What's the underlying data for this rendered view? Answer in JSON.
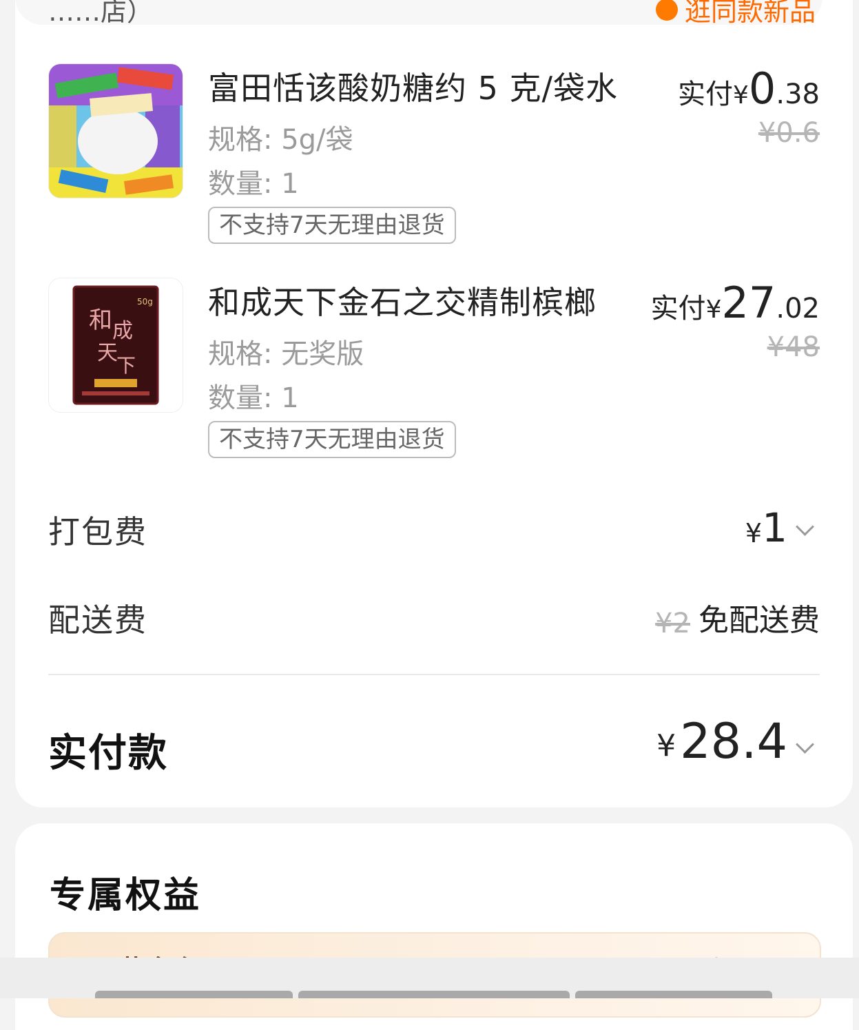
{
  "store": {
    "address_partial": "……店）",
    "right_partial": "逛同款新品"
  },
  "items": [
    {
      "name": "富田恬该酸奶糖约 5 克/袋水",
      "spec": "规格: 5g/袋",
      "qty": "数量: 1",
      "tag": "不支持7天无理由退货",
      "paid_label": "实付",
      "currency": "¥",
      "paid_int": "0",
      "paid_dec": ".38",
      "original": "¥0.6"
    },
    {
      "name": "和成天下金石之交精制槟榔",
      "spec": "规格: 无奖版",
      "qty": "数量: 1",
      "tag": "不支持7天无理由退货",
      "paid_label": "实付",
      "currency": "¥",
      "paid_int": "27",
      "paid_dec": ".02",
      "original": "¥48",
      "thumb_text": "和成天下",
      "thumb_badge": "50g"
    }
  ],
  "packing_fee": {
    "label": "打包费",
    "currency": "¥",
    "value": "1"
  },
  "delivery_fee": {
    "label": "配送费",
    "original": "¥2",
    "text": "免配送费"
  },
  "total": {
    "label": "实付款",
    "currency": "¥",
    "value": "28.4"
  },
  "benefits": {
    "title": "专属权益",
    "member_label": "黄金会员",
    "right_text": "去开通"
  },
  "colors": {
    "accent": "#ff6a00",
    "card": "#ffffff",
    "page": "#f3f3f3"
  },
  "icons": [
    "chevron-down-icon",
    "orange-dot-icon"
  ]
}
